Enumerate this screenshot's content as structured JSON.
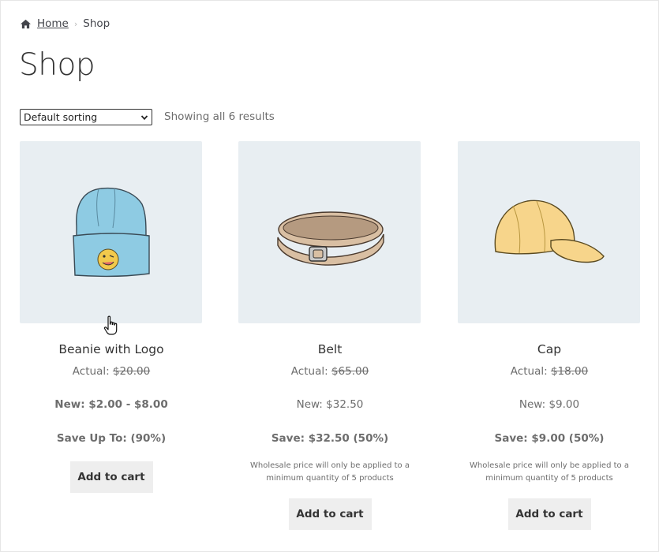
{
  "breadcrumb": {
    "home": "Home",
    "current": "Shop"
  },
  "page": {
    "title": "Shop"
  },
  "sorting": {
    "selected": "Default sorting"
  },
  "results": {
    "count_text": "Showing all 6 results"
  },
  "products": [
    {
      "name": "Beanie with Logo",
      "actual_label": "Actual:",
      "actual_price": "$20.00",
      "new_label": "New:",
      "new_price": "$2.00 - $8.00",
      "save_label": "Save Up To:",
      "save_value": "(90%)",
      "note": "",
      "button": "Add to cart",
      "image": "beanie-image"
    },
    {
      "name": "Belt",
      "actual_label": "Actual:",
      "actual_price": "$65.00",
      "new_label": "New:",
      "new_price": "$32.50",
      "save_label": "Save:",
      "save_value": "$32.50 (50%)",
      "note": "Wholesale price will only be applied to a minimum quantity of 5 products",
      "button": "Add to cart",
      "image": "belt-image"
    },
    {
      "name": "Cap",
      "actual_label": "Actual:",
      "actual_price": "$18.00",
      "new_label": "New:",
      "new_price": "$9.00",
      "save_label": "Save:",
      "save_value": "$9.00 (50%)",
      "note": "Wholesale price will only be applied to a minimum quantity of 5 products",
      "button": "Add to cart",
      "image": "cap-image"
    }
  ],
  "colors": {
    "image_bg": "#e8eef2",
    "button_bg": "#eeeeee",
    "text": "#6d6d6d"
  }
}
